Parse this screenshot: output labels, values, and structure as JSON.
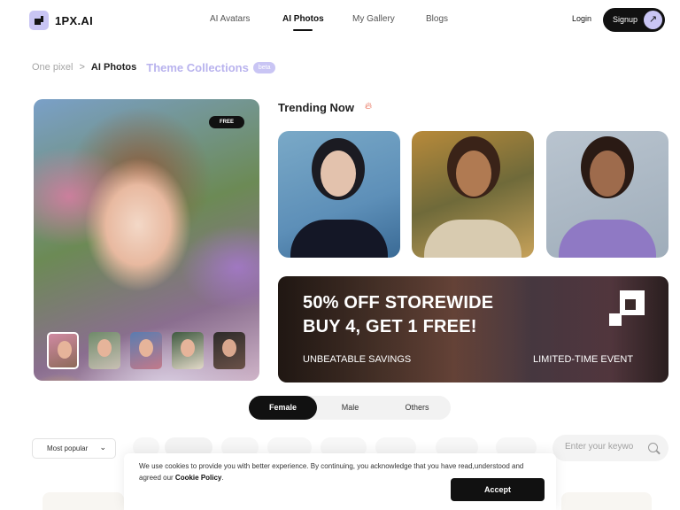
{
  "header": {
    "logo_text": "1PX.AI",
    "nav": [
      {
        "label": "AI Avatars",
        "active": false
      },
      {
        "label": "AI Photos",
        "active": true
      },
      {
        "label": "My Gallery",
        "active": false
      },
      {
        "label": "Blogs",
        "active": false
      }
    ],
    "login_label": "Login",
    "signup_label": "Signup",
    "signup_icon": "arrow-up-right-icon"
  },
  "breadcrumb": {
    "home": "One pixel",
    "separator": ">",
    "current": "AI Photos",
    "theme_link": "Theme Collections",
    "badge": "beta"
  },
  "hero": {
    "badge": "FREE",
    "thumbnail_count": 5,
    "selected_thumbnail": 1
  },
  "trending": {
    "title": "Trending Now",
    "icon": "flame-icon"
  },
  "promo": {
    "line1": "50% OFF STOREWIDE",
    "line2": "BUY 4, GET 1 FREE!",
    "sub_left": "UNBEATABLE SAVINGS",
    "sub_right": "LIMITED-TIME EVENT"
  },
  "gender_tabs": [
    {
      "label": "Female",
      "active": true
    },
    {
      "label": "Male",
      "active": false
    },
    {
      "label": "Others",
      "active": false
    }
  ],
  "filters": {
    "sort_value": "Most popular",
    "search_placeholder": "Enter your keywo"
  },
  "cookie": {
    "text": "We use cookies to provide you with better experience. By continuing, you acknowledge that you have read,understood and agreed our ",
    "link": "Cookie Policy",
    "end": ".",
    "accept_label": "Accept"
  },
  "colors": {
    "accent": "#c9c5f4",
    "dark": "#111111",
    "theme_link": "#b9b3ee"
  }
}
